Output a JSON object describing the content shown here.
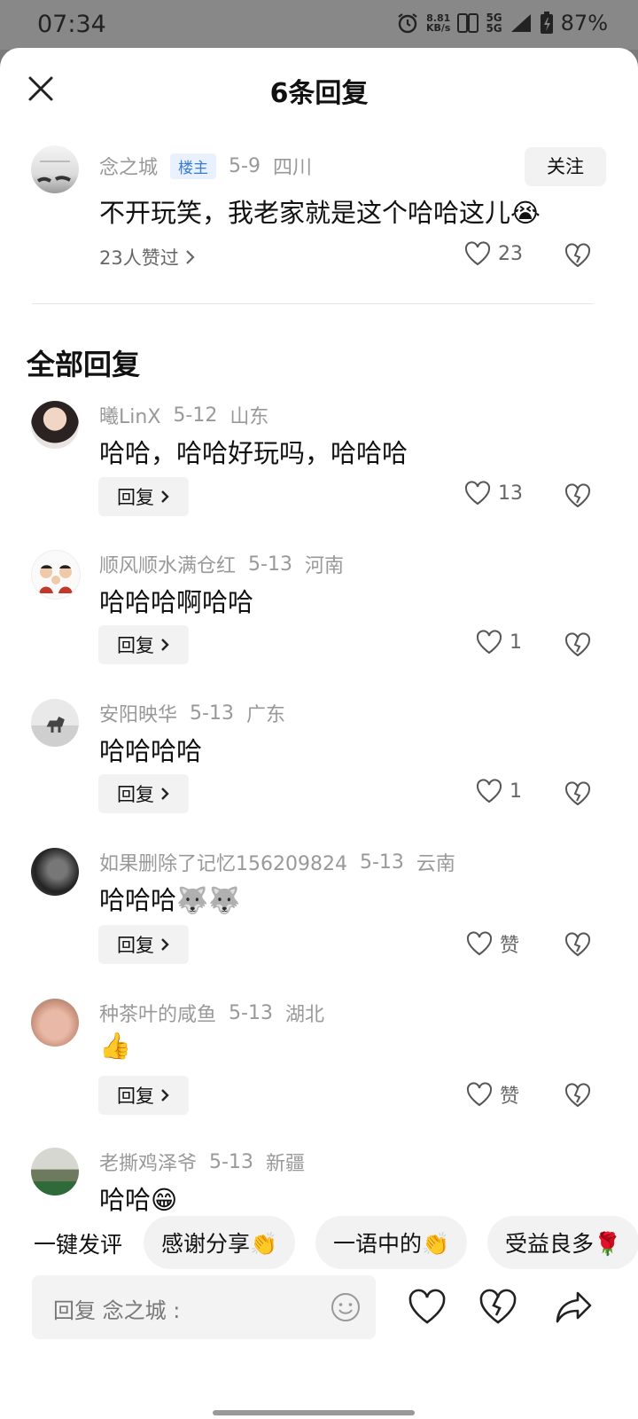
{
  "status": {
    "time": "07:34",
    "net_speed": "8.81",
    "net_unit": "KB/s",
    "network": "5G",
    "battery": "87%"
  },
  "header": {
    "title": "6条回复"
  },
  "op": {
    "name": "念之城",
    "badge": "楼主",
    "date": "5-9",
    "region": "四川",
    "text": "不开玩笑，我老家就是这个哈哈这儿😭",
    "likes_label": "23人赞过",
    "like_count": "23",
    "follow_label": "关注"
  },
  "section_title": "全部回复",
  "reply_label": "回复",
  "replies": [
    {
      "name": "曦LinX",
      "date": "5-12",
      "region": "山东",
      "text": "哈哈，哈哈好玩吗，哈哈哈",
      "likes": "13"
    },
    {
      "name": "顺风顺水满仓红",
      "date": "5-13",
      "region": "河南",
      "text": "哈哈哈啊哈哈",
      "likes": "1"
    },
    {
      "name": "安阳映华",
      "date": "5-13",
      "region": "广东",
      "text": "哈哈哈哈",
      "likes": "1"
    },
    {
      "name": "如果删除了记忆156209824",
      "date": "5-13",
      "region": "云南",
      "text": "哈哈哈🐺🐺",
      "likes": "赞"
    },
    {
      "name": "种茶叶的咸鱼",
      "date": "5-13",
      "region": "湖北",
      "text": "👍",
      "likes": "赞"
    },
    {
      "name": "老撕鸡泽爷",
      "date": "5-13",
      "region": "新疆",
      "text": "哈哈😁",
      "likes": ""
    }
  ],
  "quick": {
    "label": "一键发评",
    "chips": [
      "感谢分享👏",
      "一语中的👏",
      "受益良多🌹"
    ]
  },
  "input": {
    "placeholder": "回复 念之城 :"
  }
}
